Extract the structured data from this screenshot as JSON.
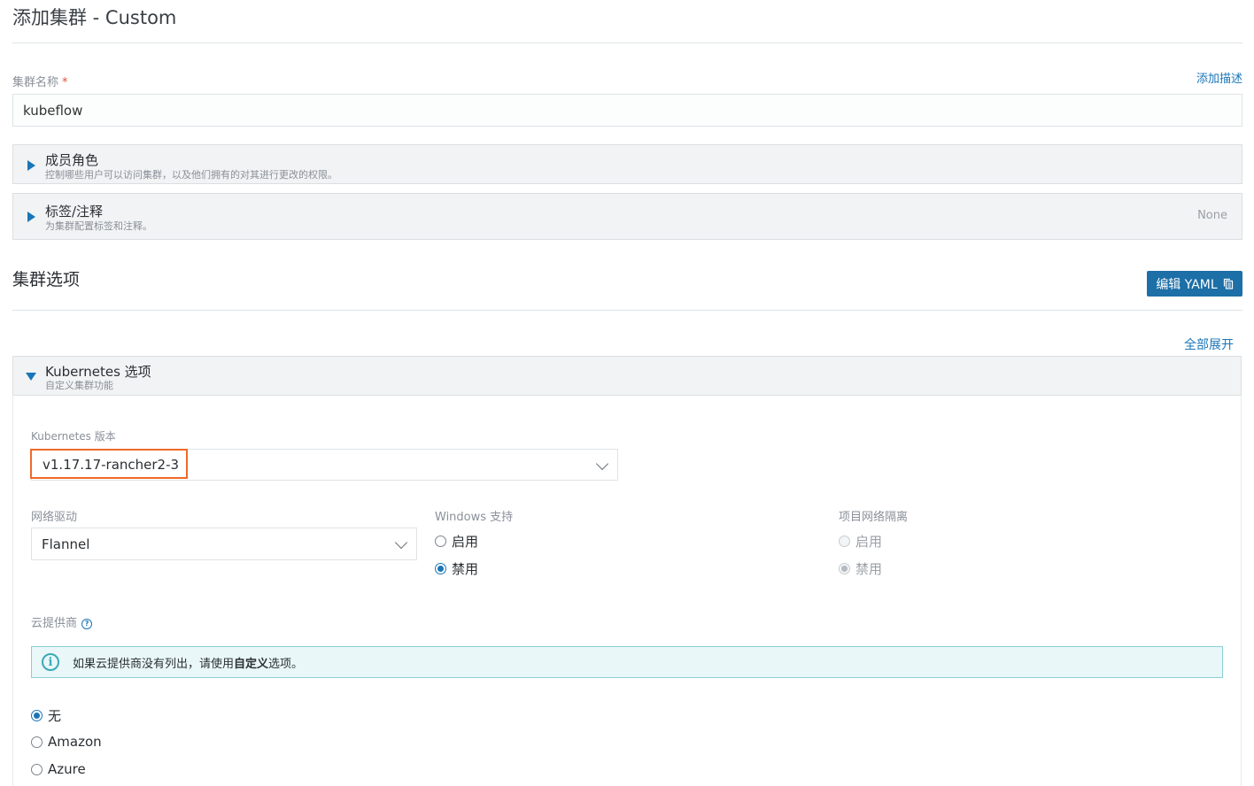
{
  "page": {
    "title": "添加集群 - Custom"
  },
  "cluster_name": {
    "label": "集群名称",
    "required_mark": "*",
    "add_description_link": "添加描述",
    "value": "kubeflow"
  },
  "members": {
    "title": "成员角色",
    "subtitle": "控制哪些用户可以访问集群，以及他们拥有的对其进行更改的权限。"
  },
  "labels": {
    "title": "标签/注释",
    "subtitle": "为集群配置标签和注释。",
    "status": "None"
  },
  "cluster_options": {
    "title": "集群选项",
    "edit_yaml_button": "编辑 YAML",
    "expand_all_link": "全部展开"
  },
  "k8s_options": {
    "title": "Kubernetes 选项",
    "subtitle": "自定义集群功能",
    "version_label": "Kubernetes 版本",
    "version_value": "v1.17.17-rancher2-3",
    "network_label": "网络驱动",
    "network_value": "Flannel",
    "windows_label": "Windows 支持",
    "windows_options": [
      "启用",
      "禁用"
    ],
    "windows_selected": "禁用",
    "isolation_label": "项目网络隔离",
    "isolation_options": [
      "启用",
      "禁用"
    ],
    "isolation_selected": "禁用",
    "cloud_label": "云提供商",
    "cloud_info_prefix": "如果云提供商没有列出，请使用",
    "cloud_info_bold": "自定义",
    "cloud_info_suffix": "选项。",
    "cloud_options": [
      "无",
      "Amazon",
      "Azure"
    ],
    "cloud_selected": "无"
  },
  "colors": {
    "accent": "#1a76b8",
    "primary_button": "#1c6fa7",
    "highlight_border": "#f06a2a",
    "info_bg": "#e9f7f8"
  }
}
